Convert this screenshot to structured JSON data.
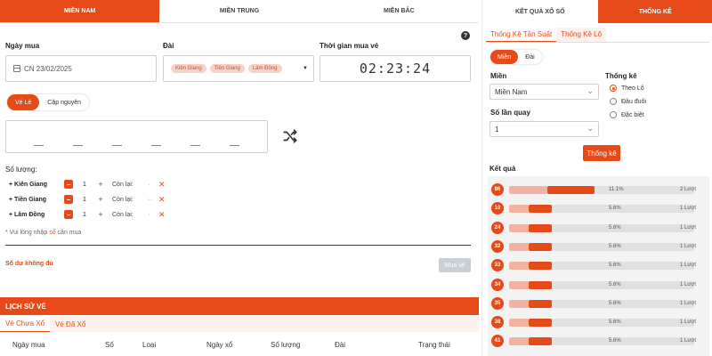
{
  "region_tabs": [
    "MIỀN NAM",
    "MIỀN TRUNG",
    "MIỀN BẮC"
  ],
  "help_icon": "?",
  "form": {
    "purchase_date_label": "Ngày mua",
    "purchase_date_value": "CN 23/02/2025",
    "station_label": "Đài",
    "stations": [
      "Kiên Giang",
      "Tiền Giang",
      "Lâm Đồng"
    ],
    "time_label": "Thời gian mua vé",
    "time_value": "02:23:24",
    "ticket_modes": [
      "Vé Lẻ",
      "Cặp nguyên"
    ],
    "quantity_label": "Số lượng:",
    "quantity_rows": [
      {
        "name": "+ Kiên Giang",
        "qty": "1",
        "remain_label": "Còn lại:"
      },
      {
        "name": "+ Tiền Giang",
        "qty": "1",
        "remain_label": "Còn lại:"
      },
      {
        "name": "+ Lâm Đồng",
        "qty": "1",
        "remain_label": "Còn lại:"
      }
    ],
    "hint_prefix": "* Vui lòng nhập",
    "hint_em": "số",
    "hint_suffix": "cần mua",
    "balance_text": "Số dư không đủ",
    "buy_button": "Mua vé"
  },
  "history": {
    "title": "LỊCH SỬ VÉ",
    "tabs": [
      "Vé Chưa Xổ",
      "Vé Đã Xổ"
    ],
    "columns": [
      "Ngày mua",
      "Số",
      "Loại",
      "Ngày xổ",
      "Số lượng",
      "Đài",
      "Trạng thái"
    ]
  },
  "right": {
    "tabs": [
      "KẾT QUẢ XỔ SỐ",
      "THỐNG KÊ"
    ],
    "stat_tabs": [
      "Thống Kê Tần Suất",
      "Thống Kê Lô"
    ],
    "region_toggle": [
      "Miền",
      "Đài"
    ],
    "mien_label": "Miền",
    "mien_value": "Miền Nam",
    "turns_label": "Số lần quay",
    "turns_value": "1",
    "stat_label": "Thống kê",
    "stat_options": [
      "Theo Lô",
      "Đầu đuôi",
      "Đặc biệt"
    ],
    "stat_button": "Thống kê",
    "result_title": "Kết quả",
    "results": [
      {
        "num": "86",
        "pct": "11.1%",
        "count": "2 Lượt",
        "frac": 0.111
      },
      {
        "num": "10",
        "pct": "5.6%",
        "count": "1 Lượt",
        "frac": 0.056
      },
      {
        "num": "24",
        "pct": "5.6%",
        "count": "1 Lượt",
        "frac": 0.056
      },
      {
        "num": "32",
        "pct": "5.6%",
        "count": "1 Lượt",
        "frac": 0.056
      },
      {
        "num": "33",
        "pct": "5.6%",
        "count": "1 Lượt",
        "frac": 0.056
      },
      {
        "num": "34",
        "pct": "5.6%",
        "count": "1 Lượt",
        "frac": 0.056
      },
      {
        "num": "35",
        "pct": "5.6%",
        "count": "1 Lượt",
        "frac": 0.056
      },
      {
        "num": "38",
        "pct": "5.6%",
        "count": "1 Lượt",
        "frac": 0.056
      },
      {
        "num": "41",
        "pct": "5.6%",
        "count": "1 Lượt",
        "frac": 0.056
      }
    ]
  },
  "colors": {
    "accent": "#e64a19",
    "chip_bg": "#f6d1c5",
    "disabled": "#c7d0d6"
  }
}
